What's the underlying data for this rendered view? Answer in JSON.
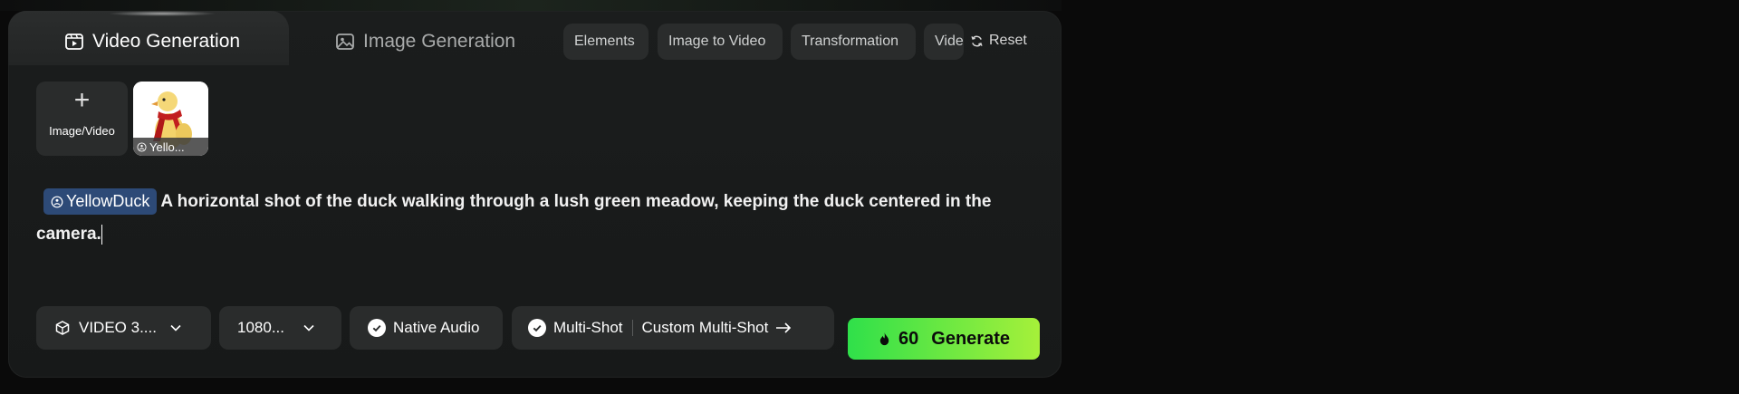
{
  "tabs": [
    {
      "label": "Video Generation",
      "active": true
    },
    {
      "label": "Image Generation",
      "active": false
    }
  ],
  "chips": [
    "Elements",
    "Image to Video",
    "Transformation",
    "Video"
  ],
  "reset_label": "Reset",
  "upload": {
    "plus": "+",
    "label": "Image/Video"
  },
  "asset": {
    "caption": "Yello..."
  },
  "prompt": {
    "mention": "YellowDuck",
    "text": "A horizontal shot of the duck walking through a lush green meadow, keeping the duck centered in the camera."
  },
  "controls": {
    "model": "VIDEO 3....",
    "resolution": "1080...",
    "native_audio": "Native Audio",
    "multi_shot": "Multi-Shot",
    "custom_multi_shot": "Custom Multi-Shot"
  },
  "generate": {
    "cost": "60",
    "label": "Generate"
  },
  "colors": {
    "accent_start": "#2fe04a",
    "accent_end": "#a6f03a",
    "mention_bg": "#2d4a77"
  }
}
